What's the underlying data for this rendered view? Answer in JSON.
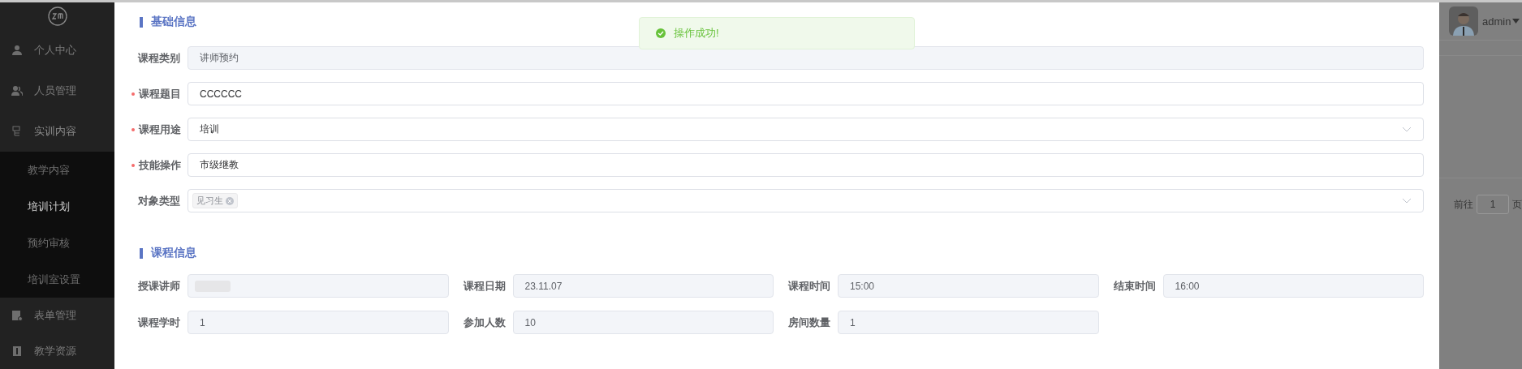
{
  "sidebar": {
    "items": [
      {
        "label": "个人中心"
      },
      {
        "label": "人员管理"
      },
      {
        "label": "实训内容",
        "expanded": true,
        "children": [
          {
            "label": "教学内容",
            "selected": false
          },
          {
            "label": "培训计划",
            "selected": true
          },
          {
            "label": "预约审核",
            "selected": false
          },
          {
            "label": "培训室设置",
            "selected": false
          }
        ]
      },
      {
        "label": "表单管理"
      },
      {
        "label": "教学资源"
      }
    ]
  },
  "header": {
    "user": "admin"
  },
  "pagination": {
    "prefix": "前往",
    "page": "1",
    "suffix": "页"
  },
  "toast": {
    "kind": "success",
    "message": "操作成功!"
  },
  "dialog": {
    "sections": [
      {
        "title": "基础信息",
        "kind": "rows",
        "fields": [
          {
            "label": "课程类别",
            "required": false,
            "kind": "input",
            "disabled": true,
            "value": "讲师预约"
          },
          {
            "label": "课程题目",
            "required": true,
            "kind": "input",
            "disabled": false,
            "value": "CCCCCC"
          },
          {
            "label": "课程用途",
            "required": true,
            "kind": "select",
            "disabled": false,
            "value": "培训"
          },
          {
            "label": "技能操作",
            "required": true,
            "kind": "input",
            "disabled": false,
            "value": "市级继教"
          },
          {
            "label": "对象类型",
            "required": false,
            "kind": "tags",
            "disabled": false,
            "tags": [
              "见习生"
            ]
          }
        ]
      },
      {
        "title": "课程信息",
        "kind": "grid",
        "fields": [
          {
            "label": "授课讲师",
            "required": false,
            "kind": "blurred",
            "disabled": true
          },
          {
            "label": "课程日期",
            "required": false,
            "kind": "input",
            "disabled": true,
            "value": "23.11.07"
          },
          {
            "label": "课程时间",
            "required": false,
            "kind": "input",
            "disabled": true,
            "value": "15:00"
          },
          {
            "label": "结束时间",
            "required": false,
            "kind": "input",
            "disabled": true,
            "value": "16:00"
          },
          {
            "label": "课程学时",
            "required": false,
            "kind": "input",
            "disabled": true,
            "value": "1"
          },
          {
            "label": "参加人数",
            "required": false,
            "kind": "input",
            "disabled": true,
            "value": "10"
          },
          {
            "label": "房间数量",
            "required": false,
            "kind": "input",
            "disabled": true,
            "value": "1"
          }
        ]
      }
    ]
  }
}
